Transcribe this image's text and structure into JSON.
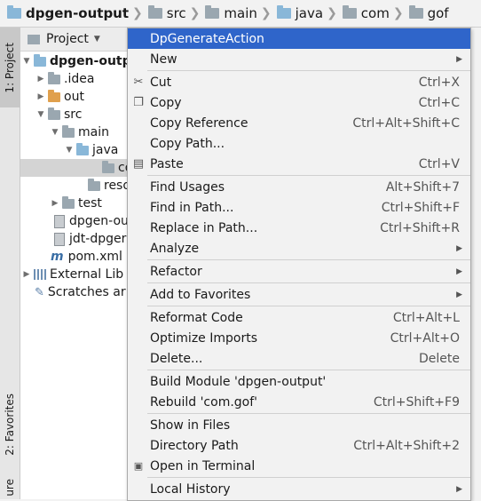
{
  "breadcrumb": [
    {
      "label": "dpgen-output",
      "icon": "module-folder-icon"
    },
    {
      "label": "src",
      "icon": "folder-icon"
    },
    {
      "label": "main",
      "icon": "folder-icon"
    },
    {
      "label": "java",
      "icon": "source-folder-icon"
    },
    {
      "label": "com",
      "icon": "folder-icon"
    },
    {
      "label": "gof",
      "icon": "folder-icon"
    }
  ],
  "sidebar": {
    "tab_project": "1: Project",
    "tab_favorites": "2: Favorites",
    "tab_structure": "ure"
  },
  "panel": {
    "title": "Project",
    "tree": [
      {
        "label": "dpgen-outp",
        "bold": true
      },
      {
        "label": ".idea"
      },
      {
        "label": "out"
      },
      {
        "label": "src"
      },
      {
        "label": "main"
      },
      {
        "label": "java"
      },
      {
        "label": "co"
      },
      {
        "label": "reso"
      },
      {
        "label": "test"
      },
      {
        "label": "dpgen-ou"
      },
      {
        "label": "jdt-dpger"
      },
      {
        "label": "pom.xml"
      },
      {
        "label": "External Lib"
      },
      {
        "label": "Scratches ar"
      }
    ]
  },
  "menu": {
    "highlight_color": "#2f65ca",
    "items": [
      {
        "label": "DpGenerateAction",
        "shortcut": ""
      },
      {
        "label": "New",
        "shortcut": ""
      },
      {
        "label": "Cut",
        "shortcut": "Ctrl+X",
        "icon": "scissors-icon"
      },
      {
        "label": "Copy",
        "shortcut": "Ctrl+C",
        "icon": "copy-icon"
      },
      {
        "label": "Copy Reference",
        "shortcut": "Ctrl+Alt+Shift+C"
      },
      {
        "label": "Copy Path...",
        "shortcut": ""
      },
      {
        "label": "Paste",
        "shortcut": "Ctrl+V",
        "icon": "clipboard-icon"
      },
      {
        "label": "Find Usages",
        "shortcut": "Alt+Shift+7"
      },
      {
        "label": "Find in Path...",
        "shortcut": "Ctrl+Shift+F"
      },
      {
        "label": "Replace in Path...",
        "shortcut": "Ctrl+Shift+R"
      },
      {
        "label": "Analyze",
        "shortcut": ""
      },
      {
        "label": "Refactor",
        "shortcut": ""
      },
      {
        "label": "Add to Favorites",
        "shortcut": ""
      },
      {
        "label": "Reformat Code",
        "shortcut": "Ctrl+Alt+L"
      },
      {
        "label": "Optimize Imports",
        "shortcut": "Ctrl+Alt+O"
      },
      {
        "label": "Delete...",
        "shortcut": "Delete"
      },
      {
        "label": "Build Module 'dpgen-output'",
        "shortcut": ""
      },
      {
        "label": "Rebuild 'com.gof'",
        "shortcut": "Ctrl+Shift+F9"
      },
      {
        "label": "Show in Files",
        "shortcut": ""
      },
      {
        "label": "Directory Path",
        "shortcut": "Ctrl+Alt+Shift+2"
      },
      {
        "label": "Open in Terminal",
        "shortcut": "",
        "icon": "terminal-icon"
      },
      {
        "label": "Local History",
        "shortcut": ""
      }
    ]
  }
}
